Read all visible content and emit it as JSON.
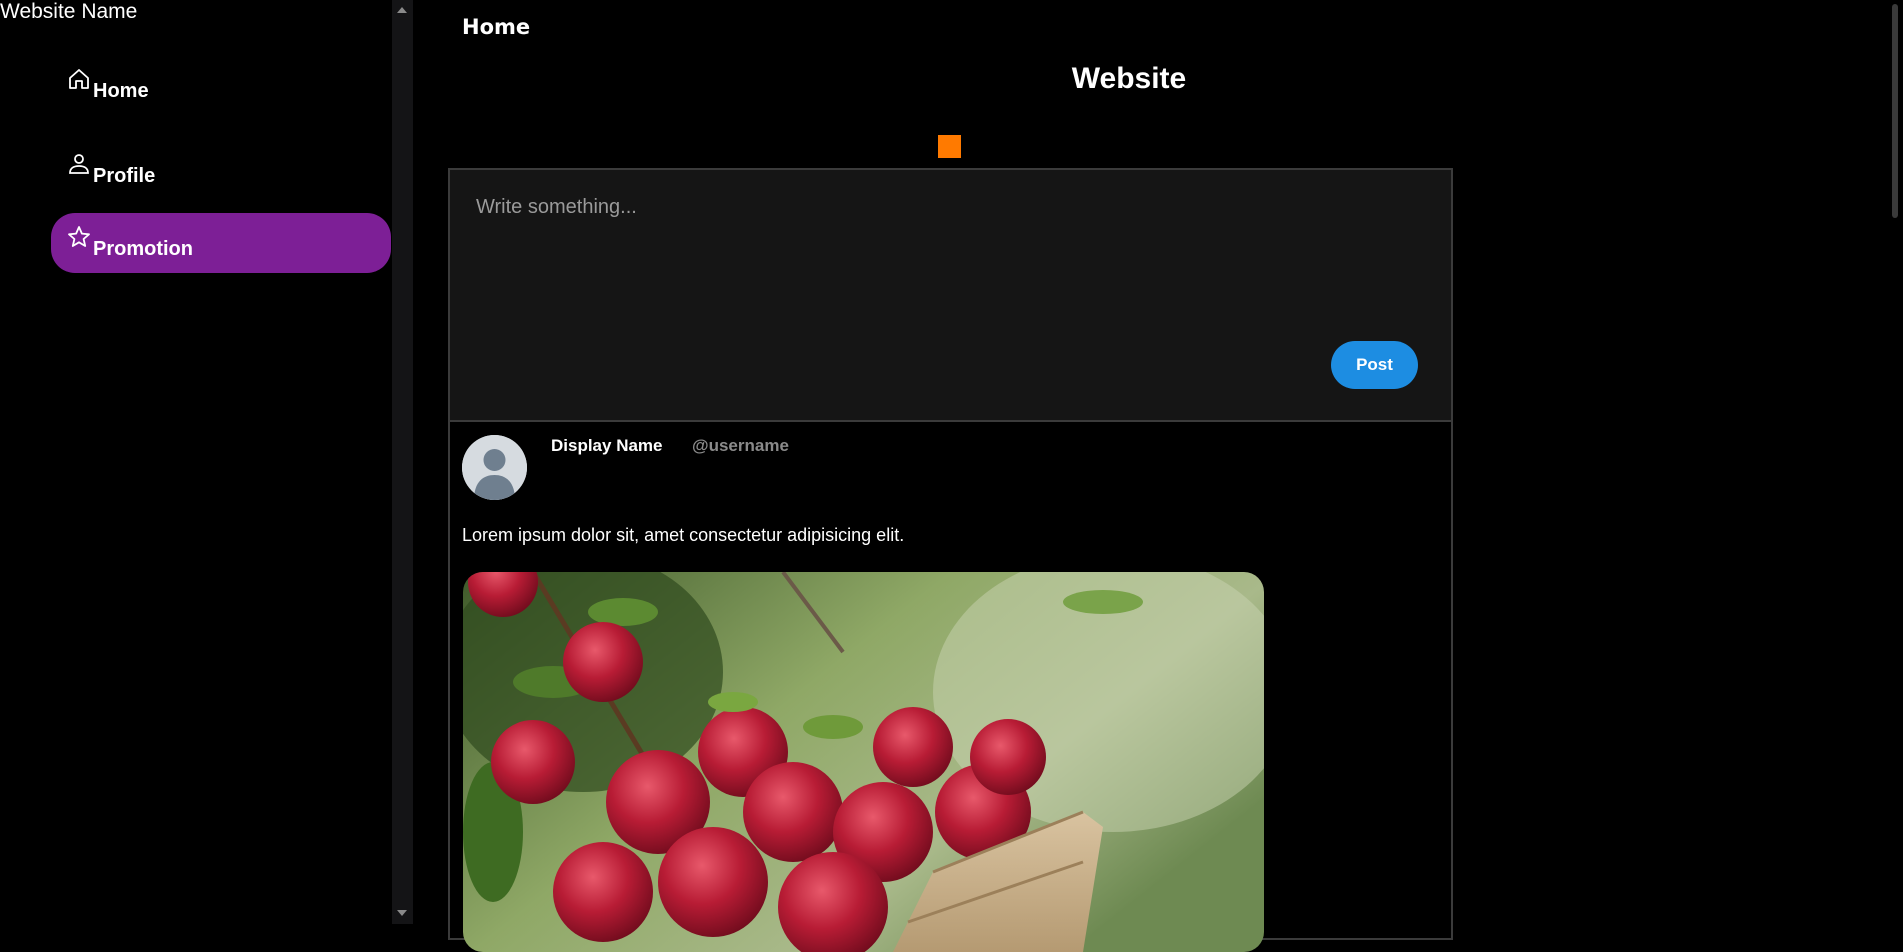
{
  "sidebar": {
    "site_name": "Website Name",
    "items": [
      {
        "label": "Home",
        "icon": "home-icon",
        "active": false
      },
      {
        "label": "Profile",
        "icon": "user-icon",
        "active": false
      },
      {
        "label": "Promotion",
        "icon": "star-icon",
        "active": true
      }
    ],
    "active_color": "#7d1f96"
  },
  "header": {
    "title": "Home",
    "site_heading": "Website"
  },
  "composer": {
    "placeholder": "Write something...",
    "value": "",
    "post_label": "Post",
    "button_color": "#1d8de2"
  },
  "post": {
    "display_name": "Display Name",
    "username": "@username",
    "text": "Lorem ipsum dolor sit, amet consectetur adipisicing elit.",
    "image_alt": "apples"
  },
  "accent_color": "#ff7a00"
}
